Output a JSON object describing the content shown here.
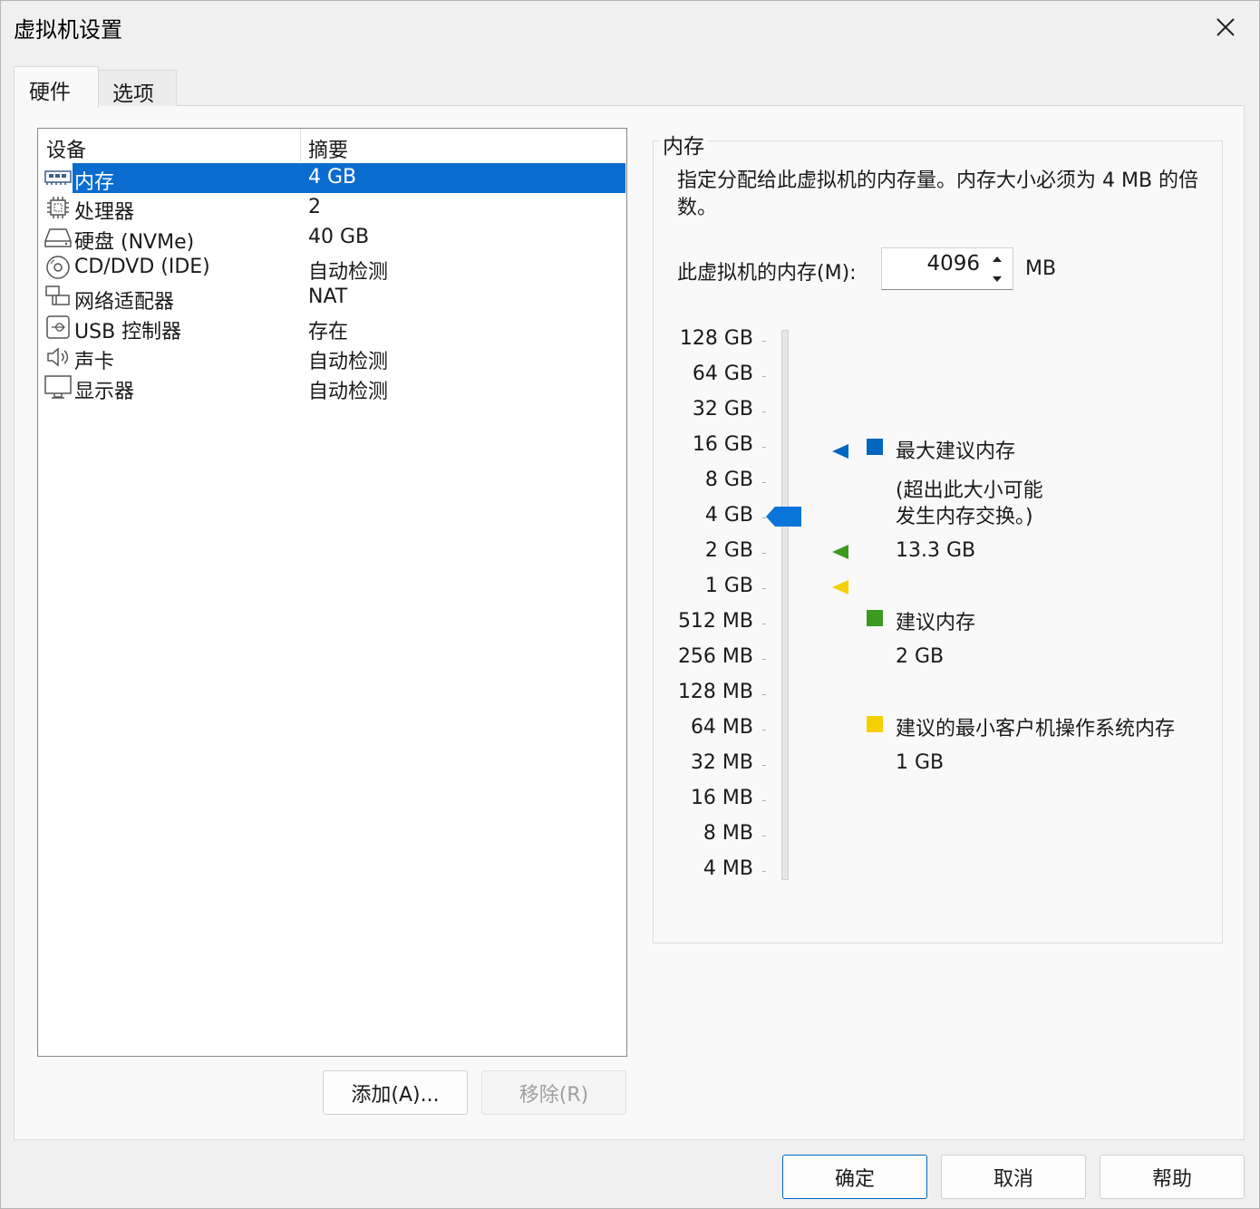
{
  "window": {
    "title": "虚拟机设置"
  },
  "tabs": [
    {
      "label": "硬件"
    },
    {
      "label": "选项"
    }
  ],
  "device_list": {
    "headers": {
      "device": "设备",
      "summary": "摘要"
    },
    "rows": [
      {
        "name": "内存",
        "summary": "4 GB",
        "icon": "memory-icon",
        "selected": true
      },
      {
        "name": "处理器",
        "summary": "2",
        "icon": "processor-icon"
      },
      {
        "name": "硬盘 (NVMe)",
        "summary": "40 GB",
        "icon": "hard-disk-icon"
      },
      {
        "name": "CD/DVD (IDE)",
        "summary": "自动检测",
        "icon": "cd-dvd-icon"
      },
      {
        "name": "网络适配器",
        "summary": "NAT",
        "icon": "network-adapter-icon"
      },
      {
        "name": "USB 控制器",
        "summary": "存在",
        "icon": "usb-icon"
      },
      {
        "name": "声卡",
        "summary": "自动检测",
        "icon": "speaker-icon"
      },
      {
        "name": "显示器",
        "summary": "自动检测",
        "icon": "monitor-icon"
      }
    ]
  },
  "buttons": {
    "add": "添加(A)...",
    "remove": "移除(R)",
    "ok": "确定",
    "cancel": "取消",
    "help": "帮助"
  },
  "memory": {
    "group_title": "内存",
    "description": "指定分配给此虚拟机的内存量。内存大小必须为 4 MB 的倍数。",
    "label": "此虚拟机的内存(M):",
    "value": "4096",
    "unit": "MB",
    "scale": [
      "128 GB",
      "64 GB",
      "32 GB",
      "16 GB",
      "8 GB",
      "4 GB",
      "2 GB",
      "1 GB",
      "512 MB",
      "256 MB",
      "128 MB",
      "64 MB",
      "32 MB",
      "16 MB",
      "8 MB",
      "4 MB"
    ],
    "slider_value": "4 GB",
    "legend": {
      "max": {
        "title": "最大建议内存",
        "note1": "(超出此大小可能",
        "note2": "发生内存交换。)",
        "value": "13.3 GB",
        "color": "#0067c0"
      },
      "recommended": {
        "title": "建议内存",
        "value": "2 GB",
        "color": "#3c9a1e"
      },
      "min": {
        "title": "建议的最小客户机操作系统内存",
        "value": "1 GB",
        "color": "#f5d000"
      }
    }
  }
}
